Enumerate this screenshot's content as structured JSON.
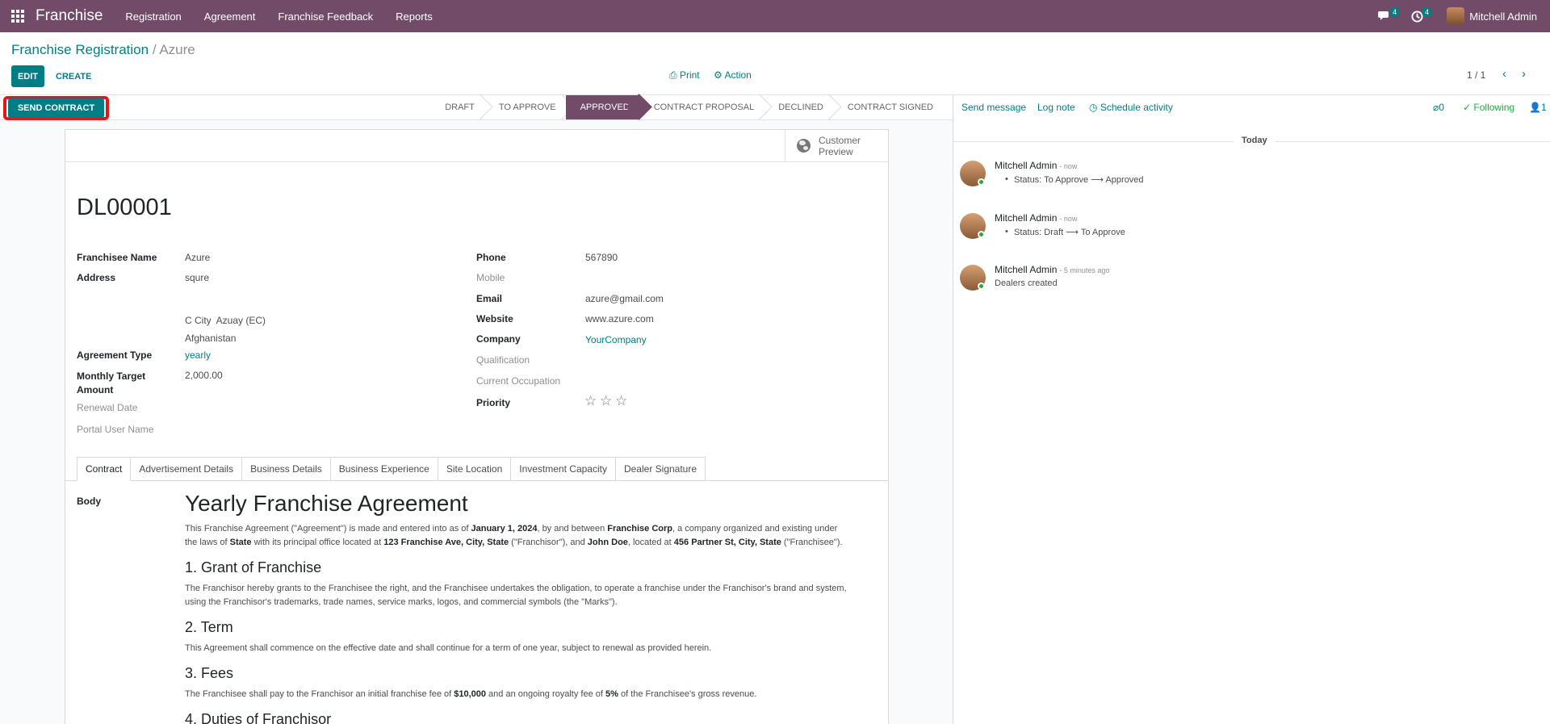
{
  "navbar": {
    "brand": "Franchise",
    "menu": [
      "Registration",
      "Agreement",
      "Franchise Feedback",
      "Reports"
    ],
    "chat_count": "4",
    "activity_count": "4",
    "user_name": "Mitchell Admin"
  },
  "breadcrumb": {
    "parent": "Franchise Registration",
    "separator": "/",
    "current": "Azure"
  },
  "toolbar": {
    "edit": "EDIT",
    "create": "CREATE",
    "print": "Print",
    "action": "Action",
    "pager": "1 / 1"
  },
  "statusbar": {
    "send_contract": "SEND CONTRACT",
    "stages": [
      "DRAFT",
      "TO APPROVE",
      "APPROVED",
      "CONTRACT PROPOSAL",
      "DECLINED",
      "CONTRACT SIGNED"
    ],
    "active_stage": "APPROVED"
  },
  "sheet": {
    "preview_label": "Customer Preview",
    "reference": "DL00001",
    "left": {
      "franchisee_name_label": "Franchisee Name",
      "franchisee_name": "Azure",
      "address_label": "Address",
      "street": "squre",
      "city_line": "C City  Azuay (EC)",
      "country": "Afghanistan",
      "agreement_type_label": "Agreement Type",
      "agreement_type": "yearly",
      "monthly_target_label": "Monthly Target Amount",
      "monthly_target": "2,000.00",
      "renewal_date_label": "Renewal Date",
      "portal_user_label": "Portal User Name"
    },
    "right": {
      "phone_label": "Phone",
      "phone": "567890",
      "mobile_label": "Mobile",
      "email_label": "Email",
      "email": "azure@gmail.com",
      "website_label": "Website",
      "website": "www.azure.com",
      "company_label": "Company",
      "company": "YourCompany",
      "qualification_label": "Qualification",
      "occupation_label": "Current Occupation",
      "priority_label": "Priority",
      "priority_stars": 0
    },
    "tabs": [
      "Contract",
      "Advertisement Details",
      "Business Details",
      "Business Experience",
      "Site Location",
      "Investment Capacity",
      "Dealer Signature"
    ],
    "active_tab": "Contract",
    "body_label": "Body",
    "doc": {
      "title": "Yearly Franchise Agreement",
      "intro": {
        "t1": "This Franchise Agreement (\"Agreement\") is made and entered into as of ",
        "date": "January 1, 2024",
        "t2": ", by and between ",
        "franchisor": "Franchise Corp",
        "t3": ", a company organized and existing under the laws of ",
        "state": "State",
        "t4": " with its principal office located at ",
        "addr1": "123 Franchise Ave, City, State",
        "t5": " (\"Franchisor\"), and ",
        "franchisee": "John Doe",
        "t6": ", located at ",
        "addr2": "456 Partner St, City, State",
        "t7": " (\"Franchisee\")."
      },
      "s1_title": "1. Grant of Franchise",
      "s1_text": "The Franchisor hereby grants to the Franchisee the right, and the Franchisee undertakes the obligation, to operate a franchise under the Franchisor's brand and system, using the Franchisor's trademarks, trade names, service marks, logos, and commercial symbols (the \"Marks\").",
      "s2_title": "2. Term",
      "s2_text": "This Agreement shall commence on the effective date and shall continue for a term of one year, subject to renewal as provided herein.",
      "s3_title": "3. Fees",
      "s3": {
        "t1": "The Franchisee shall pay to the Franchisor an initial franchise fee of ",
        "fee": "$10,000",
        "t2": " and an ongoing royalty fee of ",
        "pct": "5%",
        "t3": " of the Franchisee's gross revenue."
      },
      "s4_title": "4. Duties of Franchisor"
    }
  },
  "chatter": {
    "send_message": "Send message",
    "log_note": "Log note",
    "schedule_activity": "Schedule activity",
    "attachments": "0",
    "following": "Following",
    "followers": "1",
    "today": "Today",
    "messages": [
      {
        "author": "Mitchell Admin",
        "time": "- now",
        "from": "To Approve",
        "to": "Approved",
        "prefix": "Status: "
      },
      {
        "author": "Mitchell Admin",
        "time": "- now",
        "from": "Draft",
        "to": "To Approve",
        "prefix": "Status: "
      },
      {
        "author": "Mitchell Admin",
        "time": "- 5 minutes ago",
        "body": "Dealers created"
      }
    ]
  },
  "colors": {
    "brand": "#714b67",
    "accent": "#017e84",
    "highlight": "#e8141c"
  }
}
